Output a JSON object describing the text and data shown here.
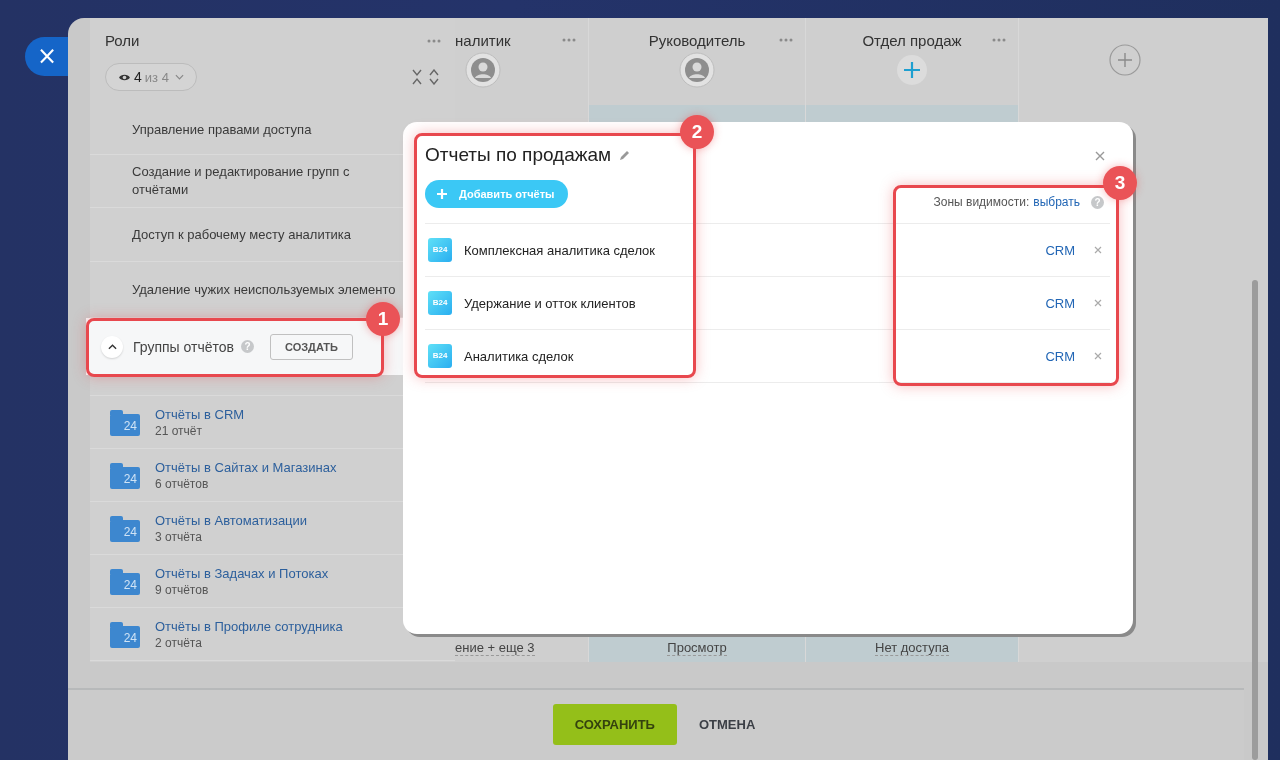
{
  "close_button": {
    "label": "×"
  },
  "roles_panel": {
    "title": "Роли",
    "filter": {
      "shown": "4",
      "total": "из 4"
    },
    "permissions": [
      "Управление правами доступа",
      "Создание и редактирование групп с отчётами",
      "Доступ к рабочему месту аналитика",
      "Удаление чужих неиспользуемых элементо"
    ],
    "report_groups": {
      "title": "Группы отчётов",
      "help": "?",
      "expanded": true,
      "create_button": "СОЗДАТЬ",
      "groups": [
        {
          "name": "Отчёты в CRM",
          "count": "21 отчёт",
          "icon_label": "24"
        },
        {
          "name": "Отчёты в Сайтах и Магазинах",
          "count": "6 отчётов",
          "icon_label": "24"
        },
        {
          "name": "Отчёты в Автоматизации",
          "count": "3 отчёта",
          "icon_label": "24"
        },
        {
          "name": "Отчёты в Задачах и Потоках",
          "count": "9 отчётов",
          "icon_label": "24"
        },
        {
          "name": "Отчёты в Профиле сотрудника",
          "count": "2 отчёта",
          "icon_label": "24"
        }
      ]
    }
  },
  "role_columns": [
    {
      "title": "налитик",
      "kind": "avatar",
      "highlighted": false,
      "cell": "ение + еще 3"
    },
    {
      "title": "Руководитель",
      "kind": "avatar",
      "highlighted": true,
      "cell": "Просмотр"
    },
    {
      "title": "Отдел продаж",
      "kind": "add",
      "highlighted": true,
      "cell": "Нет доступа"
    }
  ],
  "modal": {
    "title": "Отчеты по продажам",
    "add_button": "Добавить отчёты",
    "visibility_label": "Зоны видимости:",
    "visibility_link": "выбрать",
    "help": "?",
    "reports": [
      {
        "name": "Комплексная аналитика сделок",
        "badge": "B24",
        "zone": "CRM"
      },
      {
        "name": "Удержание и отток клиентов",
        "badge": "B24",
        "zone": "CRM"
      },
      {
        "name": "Аналитика сделок",
        "badge": "B24",
        "zone": "CRM"
      }
    ]
  },
  "annotations": [
    {
      "number": "1"
    },
    {
      "number": "2"
    },
    {
      "number": "3"
    }
  ],
  "footer": {
    "save": "СОХРАНИТЬ",
    "cancel": "ОТМЕНА"
  }
}
